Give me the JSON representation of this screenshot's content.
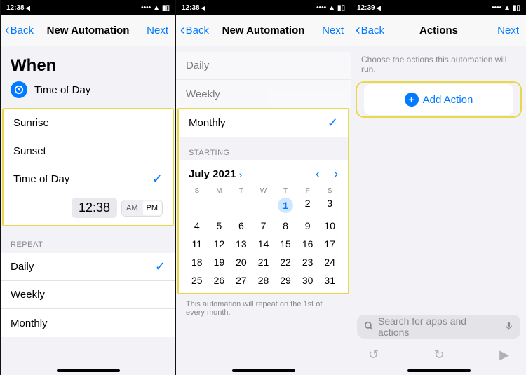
{
  "status": {
    "time1": "12:38",
    "time2": "12:38",
    "time3": "12:39",
    "loc_icon": "◀"
  },
  "nav": {
    "back": "Back",
    "next": "Next",
    "title_auto": "New Automation",
    "title_actions": "Actions"
  },
  "screen1": {
    "when": "When",
    "time_of_day": "Time of Day",
    "options": {
      "sunrise": "Sunrise",
      "sunset": "Sunset",
      "tod": "Time of Day"
    },
    "time_value": "12:38",
    "am": "AM",
    "pm": "PM",
    "repeat_label": "REPEAT",
    "repeat": {
      "daily": "Daily",
      "weekly": "Weekly",
      "monthly": "Monthly"
    }
  },
  "screen2": {
    "repeat": {
      "daily": "Daily",
      "weekly": "Weekly",
      "monthly": "Monthly"
    },
    "starting_label": "STARTING",
    "month": "July 2021",
    "dow": [
      "S",
      "M",
      "T",
      "W",
      "T",
      "F",
      "S"
    ],
    "footnote": "This automation will repeat on the 1st of every month."
  },
  "screen3": {
    "subtitle": "Choose the actions this automation will run.",
    "add_action": "Add Action",
    "search_placeholder": "Search for apps and actions"
  },
  "chart_data": {
    "type": "table",
    "title": "July 2021 calendar",
    "columns": [
      "S",
      "M",
      "T",
      "W",
      "T",
      "F",
      "S"
    ],
    "rows": [
      [
        "",
        "",
        "",
        "",
        1,
        2,
        3
      ],
      [
        4,
        5,
        6,
        7,
        8,
        9,
        10
      ],
      [
        11,
        12,
        13,
        14,
        15,
        16,
        17
      ],
      [
        18,
        19,
        20,
        21,
        22,
        23,
        24
      ],
      [
        25,
        26,
        27,
        28,
        29,
        30,
        31
      ]
    ],
    "selected": 1
  }
}
